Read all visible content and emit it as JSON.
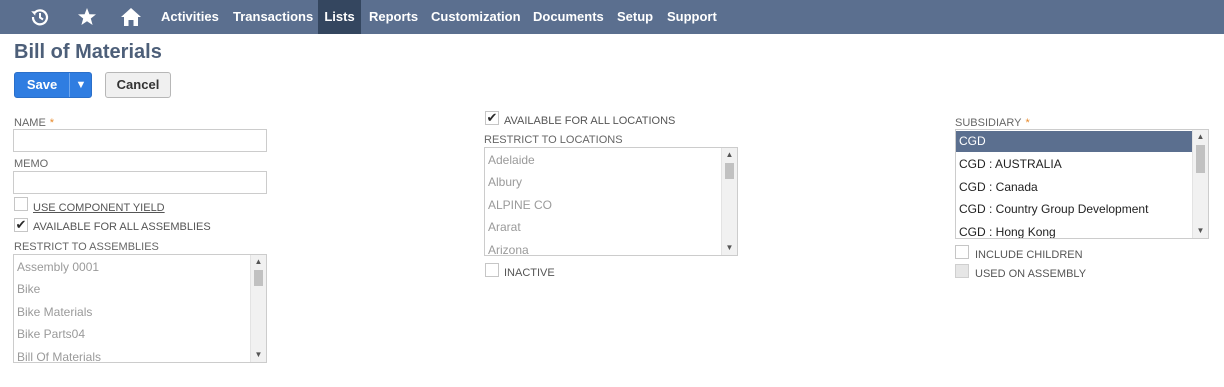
{
  "nav": {
    "icons": [
      "recent-records-icon",
      "star-icon",
      "home-icon"
    ],
    "items": [
      "Activities",
      "Transactions",
      "Lists",
      "Reports",
      "Customization",
      "Documents",
      "Setup",
      "Support"
    ],
    "active": "Lists",
    "bar_color": "#5b6f8f",
    "active_color": "#34465f"
  },
  "page": {
    "title": "Bill of Materials",
    "save_label": "Save",
    "save_dropdown_arrow": "▼",
    "cancel_label": "Cancel",
    "save_color": "#2f7de1"
  },
  "left": {
    "name_label": "NAME",
    "required_mark": "*",
    "name_value": "",
    "memo_label": "MEMO",
    "memo_value": "",
    "use_component_yield": {
      "label": "USE COMPONENT YIELD",
      "checked": false
    },
    "available_all_assemblies": {
      "label": "AVAILABLE FOR ALL ASSEMBLIES",
      "checked": true
    },
    "restrict_assemblies_label": "RESTRICT TO ASSEMBLIES",
    "assemblies": [
      "Assembly 0001",
      "Bike",
      "Bike Materials",
      "Bike Parts04",
      "Bill Of Materials"
    ]
  },
  "middle": {
    "available_all_locations": {
      "label": "AVAILABLE FOR ALL LOCATIONS",
      "checked": true
    },
    "restrict_locations_label": "RESTRICT TO LOCATIONS",
    "locations": [
      "Adelaide",
      "Albury",
      "ALPINE CO",
      "Ararat",
      "Arizona"
    ],
    "inactive": {
      "label": "INACTIVE",
      "checked": false
    }
  },
  "right": {
    "subsidiary_label": "SUBSIDIARY",
    "required_mark": "*",
    "subsidiaries": [
      "CGD",
      "CGD : AUSTRALIA",
      "CGD : Canada",
      "CGD : Country Group Development",
      "CGD : Hong Kong"
    ],
    "selected": "CGD",
    "include_children": {
      "label": "INCLUDE CHILDREN",
      "checked": false
    },
    "used_on_assembly": {
      "label": "USED ON ASSEMBLY",
      "checked": false
    }
  },
  "glyphs": {
    "check": "✔",
    "scroll_up": "▲",
    "scroll_down": "▼"
  }
}
